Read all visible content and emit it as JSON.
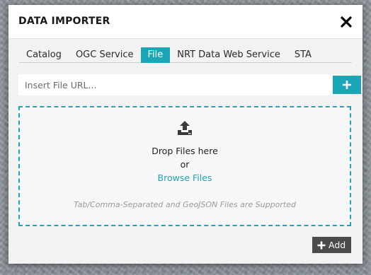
{
  "dialog": {
    "title": "DATA IMPORTER",
    "close_icon": "close-icon"
  },
  "tabs": [
    {
      "label": "Catalog",
      "active": false
    },
    {
      "label": "OGC Service",
      "active": false
    },
    {
      "label": "File",
      "active": true
    },
    {
      "label": "NRT Data Web Service",
      "active": false
    },
    {
      "label": "STA",
      "active": false
    }
  ],
  "url_field": {
    "value": "",
    "placeholder": "Insert File URL...",
    "add_icon": "plus-icon"
  },
  "dropzone": {
    "icon": "upload-icon",
    "main_text": "Drop Files here",
    "or_text": "or",
    "browse_label": "Browse Files",
    "supported_note": "Tab/Comma-Separated and GeoJSON Files are Supported"
  },
  "footer": {
    "add_label": "Add",
    "add_icon": "plus-icon"
  },
  "colors": {
    "accent": "#1aa6b7",
    "button_dark": "#4b4b4b",
    "dialog_bg": "#f2f2f2"
  }
}
